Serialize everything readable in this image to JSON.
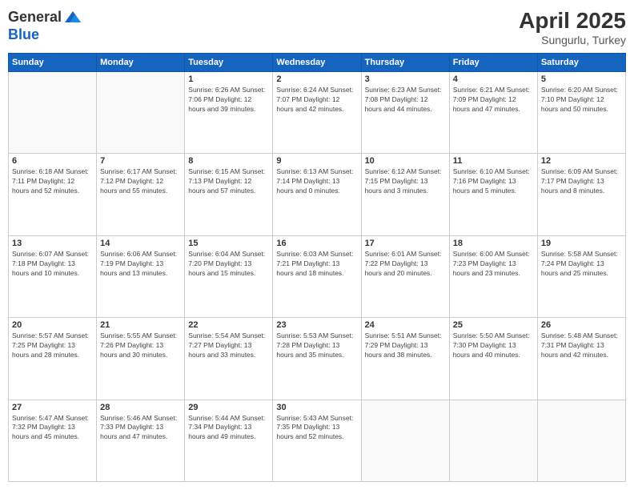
{
  "header": {
    "logo_general": "General",
    "logo_blue": "Blue",
    "month": "April 2025",
    "location": "Sungurlu, Turkey"
  },
  "weekdays": [
    "Sunday",
    "Monday",
    "Tuesday",
    "Wednesday",
    "Thursday",
    "Friday",
    "Saturday"
  ],
  "weeks": [
    [
      {
        "day": "",
        "info": ""
      },
      {
        "day": "",
        "info": ""
      },
      {
        "day": "1",
        "info": "Sunrise: 6:26 AM\nSunset: 7:06 PM\nDaylight: 12 hours\nand 39 minutes."
      },
      {
        "day": "2",
        "info": "Sunrise: 6:24 AM\nSunset: 7:07 PM\nDaylight: 12 hours\nand 42 minutes."
      },
      {
        "day": "3",
        "info": "Sunrise: 6:23 AM\nSunset: 7:08 PM\nDaylight: 12 hours\nand 44 minutes."
      },
      {
        "day": "4",
        "info": "Sunrise: 6:21 AM\nSunset: 7:09 PM\nDaylight: 12 hours\nand 47 minutes."
      },
      {
        "day": "5",
        "info": "Sunrise: 6:20 AM\nSunset: 7:10 PM\nDaylight: 12 hours\nand 50 minutes."
      }
    ],
    [
      {
        "day": "6",
        "info": "Sunrise: 6:18 AM\nSunset: 7:11 PM\nDaylight: 12 hours\nand 52 minutes."
      },
      {
        "day": "7",
        "info": "Sunrise: 6:17 AM\nSunset: 7:12 PM\nDaylight: 12 hours\nand 55 minutes."
      },
      {
        "day": "8",
        "info": "Sunrise: 6:15 AM\nSunset: 7:13 PM\nDaylight: 12 hours\nand 57 minutes."
      },
      {
        "day": "9",
        "info": "Sunrise: 6:13 AM\nSunset: 7:14 PM\nDaylight: 13 hours\nand 0 minutes."
      },
      {
        "day": "10",
        "info": "Sunrise: 6:12 AM\nSunset: 7:15 PM\nDaylight: 13 hours\nand 3 minutes."
      },
      {
        "day": "11",
        "info": "Sunrise: 6:10 AM\nSunset: 7:16 PM\nDaylight: 13 hours\nand 5 minutes."
      },
      {
        "day": "12",
        "info": "Sunrise: 6:09 AM\nSunset: 7:17 PM\nDaylight: 13 hours\nand 8 minutes."
      }
    ],
    [
      {
        "day": "13",
        "info": "Sunrise: 6:07 AM\nSunset: 7:18 PM\nDaylight: 13 hours\nand 10 minutes."
      },
      {
        "day": "14",
        "info": "Sunrise: 6:06 AM\nSunset: 7:19 PM\nDaylight: 13 hours\nand 13 minutes."
      },
      {
        "day": "15",
        "info": "Sunrise: 6:04 AM\nSunset: 7:20 PM\nDaylight: 13 hours\nand 15 minutes."
      },
      {
        "day": "16",
        "info": "Sunrise: 6:03 AM\nSunset: 7:21 PM\nDaylight: 13 hours\nand 18 minutes."
      },
      {
        "day": "17",
        "info": "Sunrise: 6:01 AM\nSunset: 7:22 PM\nDaylight: 13 hours\nand 20 minutes."
      },
      {
        "day": "18",
        "info": "Sunrise: 6:00 AM\nSunset: 7:23 PM\nDaylight: 13 hours\nand 23 minutes."
      },
      {
        "day": "19",
        "info": "Sunrise: 5:58 AM\nSunset: 7:24 PM\nDaylight: 13 hours\nand 25 minutes."
      }
    ],
    [
      {
        "day": "20",
        "info": "Sunrise: 5:57 AM\nSunset: 7:25 PM\nDaylight: 13 hours\nand 28 minutes."
      },
      {
        "day": "21",
        "info": "Sunrise: 5:55 AM\nSunset: 7:26 PM\nDaylight: 13 hours\nand 30 minutes."
      },
      {
        "day": "22",
        "info": "Sunrise: 5:54 AM\nSunset: 7:27 PM\nDaylight: 13 hours\nand 33 minutes."
      },
      {
        "day": "23",
        "info": "Sunrise: 5:53 AM\nSunset: 7:28 PM\nDaylight: 13 hours\nand 35 minutes."
      },
      {
        "day": "24",
        "info": "Sunrise: 5:51 AM\nSunset: 7:29 PM\nDaylight: 13 hours\nand 38 minutes."
      },
      {
        "day": "25",
        "info": "Sunrise: 5:50 AM\nSunset: 7:30 PM\nDaylight: 13 hours\nand 40 minutes."
      },
      {
        "day": "26",
        "info": "Sunrise: 5:48 AM\nSunset: 7:31 PM\nDaylight: 13 hours\nand 42 minutes."
      }
    ],
    [
      {
        "day": "27",
        "info": "Sunrise: 5:47 AM\nSunset: 7:32 PM\nDaylight: 13 hours\nand 45 minutes."
      },
      {
        "day": "28",
        "info": "Sunrise: 5:46 AM\nSunset: 7:33 PM\nDaylight: 13 hours\nand 47 minutes."
      },
      {
        "day": "29",
        "info": "Sunrise: 5:44 AM\nSunset: 7:34 PM\nDaylight: 13 hours\nand 49 minutes."
      },
      {
        "day": "30",
        "info": "Sunrise: 5:43 AM\nSunset: 7:35 PM\nDaylight: 13 hours\nand 52 minutes."
      },
      {
        "day": "",
        "info": ""
      },
      {
        "day": "",
        "info": ""
      },
      {
        "day": "",
        "info": ""
      }
    ]
  ]
}
